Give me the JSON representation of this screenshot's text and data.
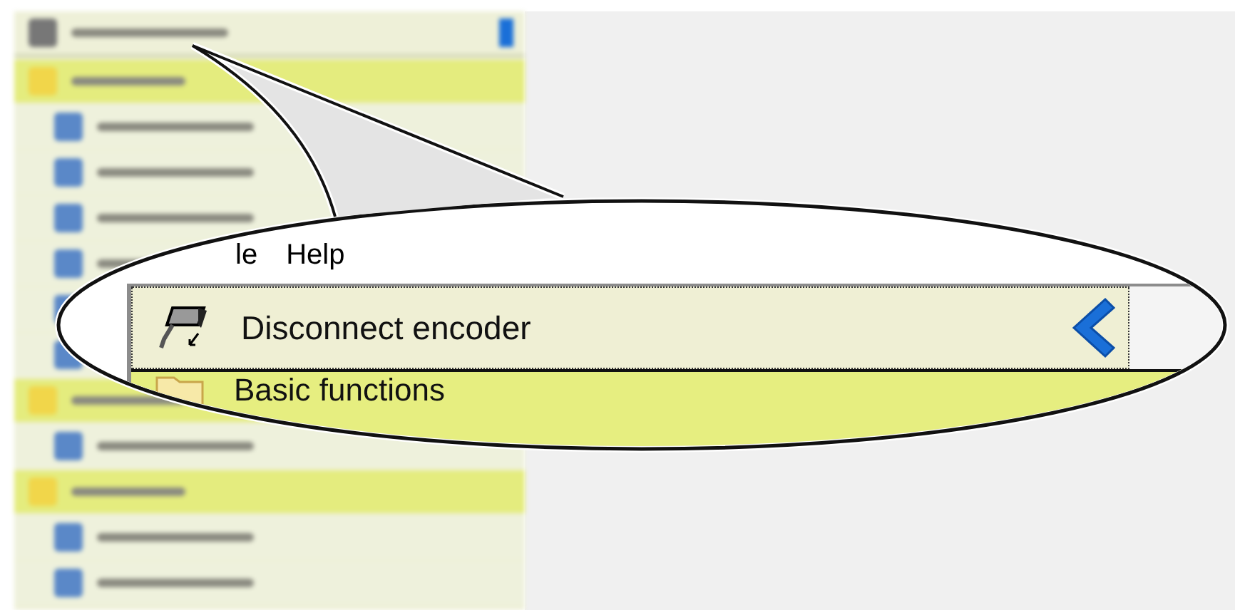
{
  "sidebar": {
    "rows": [
      {
        "kind": "top"
      },
      {
        "kind": "group"
      },
      {
        "kind": "item"
      },
      {
        "kind": "item"
      },
      {
        "kind": "item"
      },
      {
        "kind": "item"
      },
      {
        "kind": "item"
      },
      {
        "kind": "item"
      },
      {
        "kind": "group"
      },
      {
        "kind": "item"
      },
      {
        "kind": "group"
      },
      {
        "kind": "item"
      },
      {
        "kind": "item"
      }
    ]
  },
  "magnifier": {
    "menu": [
      "le",
      "Help"
    ],
    "rows": [
      {
        "kind": "action",
        "label": "Disconnect encoder"
      },
      {
        "kind": "group",
        "label": "Basic functions"
      }
    ]
  }
}
